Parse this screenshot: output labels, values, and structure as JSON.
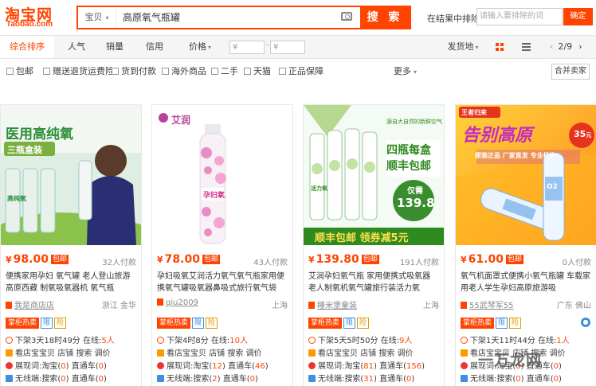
{
  "logo": {
    "cn": "淘宝网",
    "en": "Taobao.com"
  },
  "search": {
    "scope": "宝贝",
    "query": "高原氧气瓶罐",
    "button": "搜 索"
  },
  "within": {
    "label": "在结果中排除",
    "placeholder": "请输入要排除的词",
    "button": "确定"
  },
  "sortbar": {
    "items": [
      "综合排序",
      "人气",
      "销量",
      "信用",
      "价格"
    ],
    "price_from": "¥",
    "price_to": "¥",
    "price_dash": "-",
    "ship_from": "发货地",
    "page": "2/9"
  },
  "filters": [
    "包邮",
    "赠送退货运费险",
    "货到付款",
    "海外商品",
    "二手",
    "天猫",
    "正品保障"
  ],
  "filters_more": "更多",
  "merge_button": "合并卖家",
  "products": [
    {
      "banner_title": "医用高纯氧",
      "banner_sub": "三瓶盒装",
      "can_text": "高纯氧",
      "price": "98.00",
      "currency": "¥",
      "mail": "包邮",
      "paid": "32人付款",
      "title": "便携家用孕妇 氧气罐 老人登山旅游高原西藏 制氧吸氧器机 氧气瓶",
      "shop": "我是商店店",
      "location": "浙江 金华",
      "tags": [
        "掌柜热卖",
        "限",
        "险"
      ],
      "countdown": "下架3天18时49分",
      "online_label": "在线:",
      "online_num": "5",
      "online_unit": "人",
      "l2_a": "看店宝",
      "l2_b": "宝贝",
      "l2_c": "店铺",
      "l2_d": "搜索",
      "l2_e": "调价",
      "l3_label": "展现词:",
      "l3_a": "淘宝",
      "l3_an": "0",
      "l3_b": "直通车",
      "l3_bn": "0",
      "l4_label": "无线端:",
      "l4_a": "搜索",
      "l4_an": "0",
      "l4_b": "直通车",
      "l4_bn": "0"
    },
    {
      "banner_title": "艾润",
      "can_text": "孕妇氧",
      "price": "78.00",
      "currency": "¥",
      "mail": "包邮",
      "paid": "43人付款",
      "title": "孕妇吸氧艾润活力氧气氧气瓶家用便携氧气罐吸氧器鼻吸式旅行氧气袋",
      "shop": "qiu2009",
      "location": "上海",
      "tags": [
        "掌柜热卖",
        "限",
        "险"
      ],
      "countdown": "下架4时8分",
      "online_label": "在线:",
      "online_num": "10",
      "online_unit": "人",
      "l2_a": "看店宝",
      "l2_b": "宝贝",
      "l2_c": "店铺",
      "l2_d": "搜索",
      "l2_e": "调价",
      "l3_label": "展现词:",
      "l3_a": "淘宝",
      "l3_an": "12",
      "l3_b": "直通车",
      "l3_bn": "46",
      "l4_label": "无线端:",
      "l4_a": "搜索",
      "l4_an": "2",
      "l4_b": "直通车",
      "l4_bn": "0"
    },
    {
      "banner_title": "四瓶每盒",
      "banner_sub": "顺丰包邮",
      "banner_note": "源自大自然的新鲜空气",
      "price_tag_label": "仅需",
      "price_tag": "139.8",
      "banner_bottom": "顺丰包邮 领券减5元",
      "can_text": "活力氧",
      "price": "139.80",
      "currency": "¥",
      "mail": "包邮",
      "paid": "191人付款",
      "title": "艾润孕妇氧气瓶 家用便携式吸氧器 老人制氧机氧气罐旅行装活力氧",
      "shop": "睡米堡童装",
      "location": "上海",
      "tags": [
        "掌柜热卖",
        "限",
        "险"
      ],
      "countdown": "下架5天5时50分",
      "online_label": "在线:",
      "online_num": "9",
      "online_unit": "人",
      "l2_a": "看店宝",
      "l2_b": "宝贝",
      "l2_c": "店铺",
      "l2_d": "搜索",
      "l2_e": "调价",
      "l3_label": "展现词:",
      "l3_a": "淘宝",
      "l3_an": "81",
      "l3_b": "直通车",
      "l3_bn": "156",
      "l4_label": "无线端:",
      "l4_a": "搜索",
      "l4_an": "31",
      "l4_b": "直通车",
      "l4_bn": "0"
    },
    {
      "banner_title": "告别高原",
      "banner_top": "王者归来",
      "price_tag": "35",
      "price_tag_unit": "元",
      "banner_chips": [
        "原装正品",
        "厂家直发",
        "专业机构"
      ],
      "can_text": "O2",
      "price": "61.00",
      "currency": "¥",
      "mail": "包邮",
      "paid": "0人付款",
      "title": "氧气机面罩式便携小氧气瓶罐 车载家用老人学生孕妇高原旅游吸",
      "shop": "55武琴军55",
      "location": "广东 佛山",
      "tags": [
        "掌柜热卖",
        "限",
        "险"
      ],
      "countdown": "下架1天11时44分",
      "online_label": "在线:",
      "online_num": "1",
      "online_unit": "人",
      "l2_a": "看店宝",
      "l2_b": "宝贝",
      "l2_c": "店铺",
      "l2_d": "搜索",
      "l2_e": "调价",
      "l3_label": "展现词:",
      "l3_a": "淘宝",
      "l3_an": "0",
      "l3_b": "直通车",
      "l3_bn": "0",
      "l4_label": "无线端:",
      "l4_a": "搜索",
      "l4_an": "0",
      "l4_b": "直通车",
      "l4_bn": "0"
    }
  ],
  "watermark": "一万龙网",
  "colors": {
    "brand": "#ff4400",
    "link": "#3d8fe0",
    "gold": "#e09a00"
  }
}
